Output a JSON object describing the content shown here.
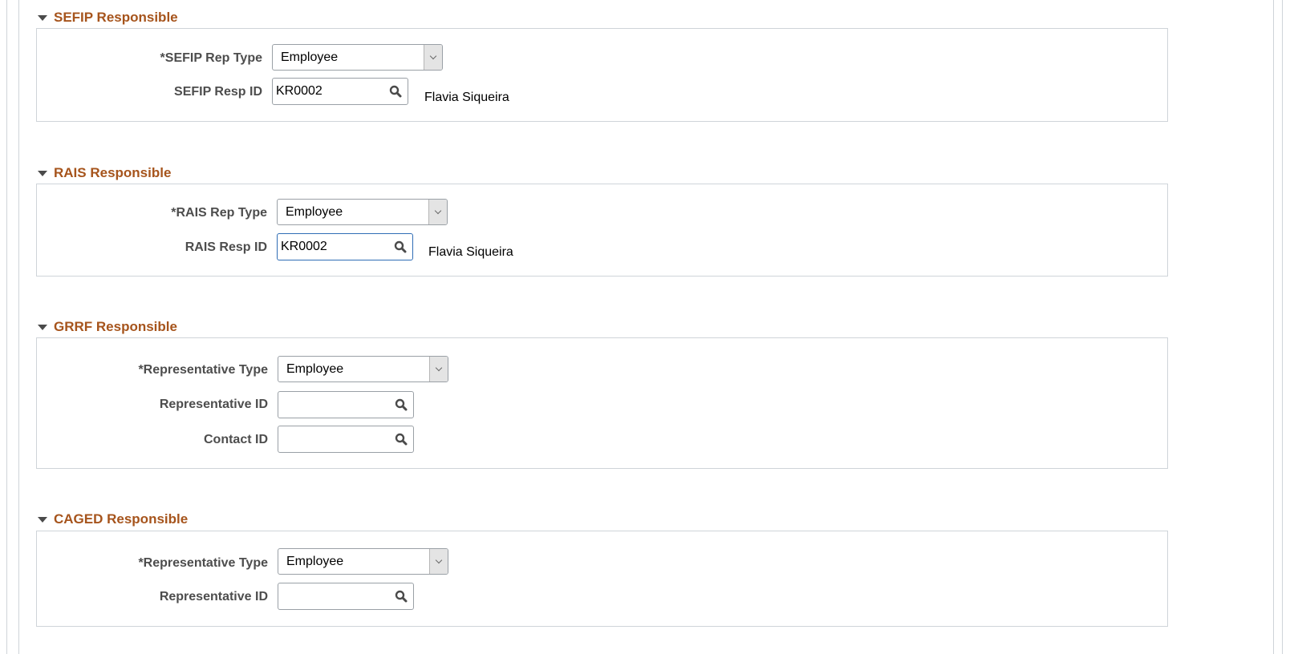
{
  "sections": [
    {
      "title": "SEFIP Responsible",
      "fields": [
        {
          "label": "*SEFIP Rep Type",
          "type": "select",
          "value": "Employee"
        },
        {
          "label": "SEFIP Resp ID",
          "type": "lookup",
          "value": "KR0002",
          "description": "Flavia Siqueira"
        }
      ]
    },
    {
      "title": "RAIS Responsible",
      "fields": [
        {
          "label": "*RAIS Rep Type",
          "type": "select",
          "value": "Employee"
        },
        {
          "label": "RAIS Resp ID",
          "type": "lookup",
          "value": "KR0002",
          "description": "Flavia Siqueira",
          "focused": true
        }
      ]
    },
    {
      "title": "GRRF Responsible",
      "fields": [
        {
          "label": "*Representative Type",
          "type": "select",
          "value": "Employee"
        },
        {
          "label": "Representative ID",
          "type": "lookup",
          "value": ""
        },
        {
          "label": "Contact ID",
          "type": "lookup",
          "value": ""
        }
      ]
    },
    {
      "title": "CAGED Responsible",
      "fields": [
        {
          "label": "*Representative Type",
          "type": "select",
          "value": "Employee"
        },
        {
          "label": "Representative ID",
          "type": "lookup",
          "value": ""
        }
      ]
    }
  ],
  "icons": {
    "collapse": "caret-down-icon",
    "dropdown": "chevron-down-icon",
    "lookup": "search-icon"
  },
  "colors": {
    "section_title": "#a6541c",
    "label": "#4d4d4d",
    "border": "#cfd4d9",
    "focus_border": "#2f6db5"
  }
}
